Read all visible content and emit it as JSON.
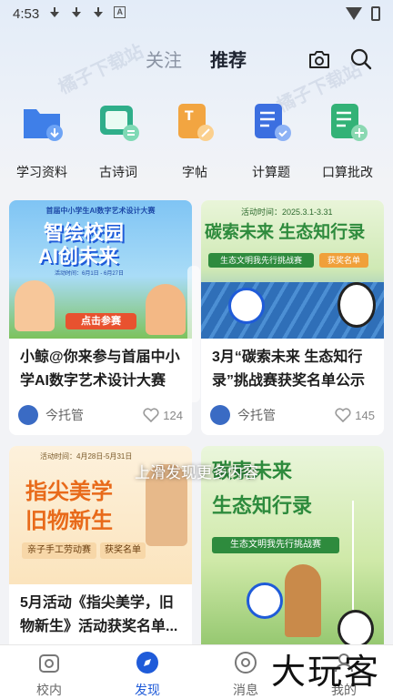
{
  "statusbar": {
    "time": "4:53"
  },
  "watermark": {
    "text": "橘子下载站"
  },
  "tabs": {
    "follow": "关注",
    "recommend": "推荐"
  },
  "categories": [
    {
      "label": "学习资料",
      "color": "#3f7fe8"
    },
    {
      "label": "古诗词",
      "color": "#2fae8a"
    },
    {
      "label": "字帖",
      "color": "#f2a541"
    },
    {
      "label": "计算题",
      "color": "#3c6fe0"
    },
    {
      "label": "口算批改",
      "color": "#33b277"
    }
  ],
  "cards": [
    {
      "banner_top": "首届中小学生AI数字艺术设计大赛",
      "banner_main1": "智绘校园",
      "banner_main2": "AI创未来",
      "banner_date": "活动时间：6月1日 - 6月27日",
      "banner_button": "点击参赛",
      "title": "小鲸@你来参与首届中小学AI数字艺术设计大赛",
      "author": "今托管",
      "likes": ""
    },
    {
      "banner_top": "活动时间：2025.3.1-3.31",
      "banner_main": "碳索未来 生态知行录",
      "banner_sub": "生态文明我先行挑战赛",
      "banner_badge": "获奖名单",
      "title": "3月“碳索未来 生态知行录”挑战赛获奖名单公示",
      "author": "今托管",
      "likes": "145"
    },
    {
      "banner_top": "活动时间：4月28日-5月31日",
      "banner_main1": "指尖美学",
      "banner_main2": "旧物新生",
      "banner_sub": "亲子手工劳动赛",
      "banner_badge": "获奖名单",
      "title": "5月活动《指尖美学，旧物新生》活动获奖名单..."
    },
    {
      "banner_main1": "碳索未来",
      "banner_main2": "生态知行录",
      "banner_sub": "生态文明我先行挑战赛"
    }
  ],
  "card1_likes": "124",
  "swipe_hint": "上滑发现更多内容",
  "nav": [
    {
      "label": "校内"
    },
    {
      "label": "发现"
    },
    {
      "label": "消息"
    },
    {
      "label": "我的"
    }
  ],
  "brand": "大玩客",
  "colors": {
    "accent": "#1f5bd9",
    "green_banner": "#2e8b3d",
    "orange_banner": "#f0a03a"
  }
}
